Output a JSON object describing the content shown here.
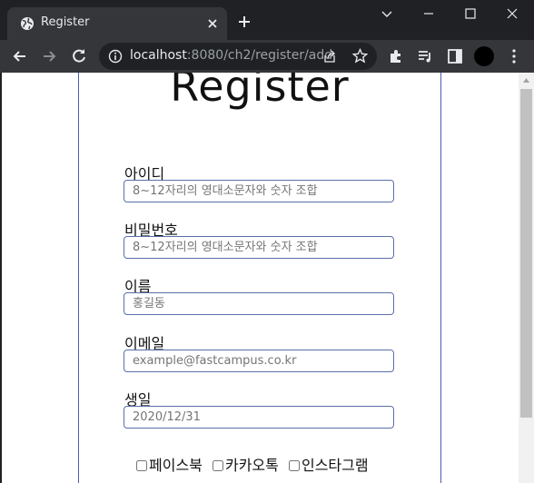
{
  "browser": {
    "tab_title": "Register",
    "url_host": "localhost",
    "url_rest": ":8080/ch2/register/add"
  },
  "page": {
    "title": "Register",
    "fields": [
      {
        "label": "아이디",
        "placeholder": "8~12자리의 영대소문자와 숫자 조합",
        "value": ""
      },
      {
        "label": "비밀번호",
        "placeholder": "8~12자리의 영대소문자와 숫자 조합",
        "value": ""
      },
      {
        "label": "이름",
        "placeholder": "홍길동",
        "value": ""
      },
      {
        "label": "이메일",
        "placeholder": "example@fastcampus.co.kr",
        "value": ""
      },
      {
        "label": "생일",
        "placeholder": "2020/12/31",
        "value": ""
      }
    ],
    "sns_options": [
      {
        "label": "페이스북",
        "checked": false
      },
      {
        "label": "카카오톡",
        "checked": false
      },
      {
        "label": "인스타그램",
        "checked": false
      }
    ]
  },
  "colors": {
    "tab_bar": "#202124",
    "toolbar": "#35363a",
    "form_border": "#4a5fb0",
    "input_border": "#5b6fa8"
  },
  "icons": {
    "favicon": "globe-icon",
    "tab_close": "close-icon",
    "new_tab": "plus-icon",
    "back": "arrow-left-icon",
    "forward": "arrow-right-icon",
    "reload": "reload-icon",
    "site_info": "info-icon",
    "share": "share-icon",
    "bookmark": "star-icon",
    "extensions": "puzzle-icon",
    "media": "media-queue-icon",
    "side_panel": "side-panel-icon",
    "menu": "kebab-menu-icon"
  }
}
